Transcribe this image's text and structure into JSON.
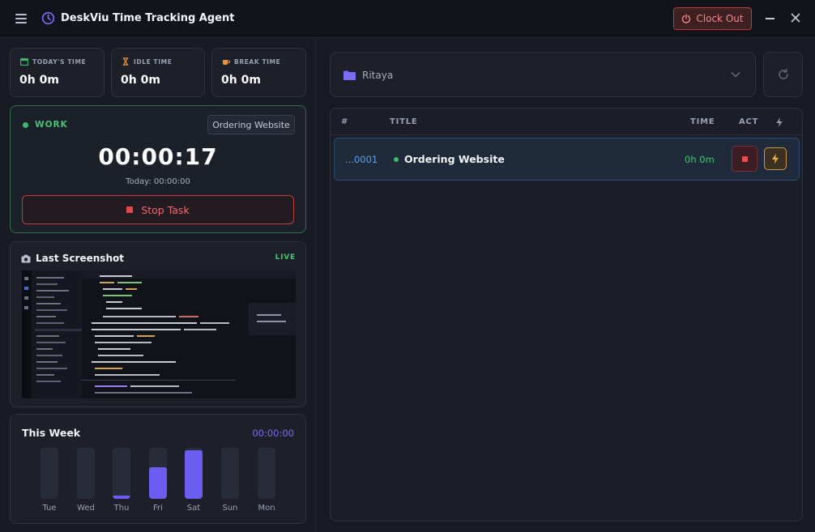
{
  "app": {
    "title": "DeskViu Time Tracking Agent",
    "clock_out_label": "Clock Out"
  },
  "stats": [
    {
      "label": "TODAY'S TIME",
      "value": "0h 0m",
      "icon": "calendar-icon",
      "color": "#3fb86b"
    },
    {
      "label": "IDLE TIME",
      "value": "0h 0m",
      "icon": "hourglass-icon",
      "color": "#e8913a"
    },
    {
      "label": "BREAK TIME",
      "value": "0h 0m",
      "icon": "coffee-icon",
      "color": "#e8913a"
    }
  ],
  "work": {
    "status_label": "WORK",
    "project_tag": "Ordering Website",
    "timer": "00:00:17",
    "today_line": "Today: 00:00:00",
    "stop_label": "Stop Task"
  },
  "screenshot": {
    "title": "Last Screenshot",
    "live_label": "LIVE"
  },
  "week": {
    "title": "This Week",
    "total": "00:00:00",
    "days": [
      {
        "label": "Tue",
        "level": 0.0
      },
      {
        "label": "Wed",
        "level": 0.0
      },
      {
        "label": "Thu",
        "level": 0.06
      },
      {
        "label": "Fri",
        "level": 0.62
      },
      {
        "label": "Sat",
        "level": 0.96
      },
      {
        "label": "Sun",
        "level": 0.0
      },
      {
        "label": "Mon",
        "level": 0.0
      }
    ]
  },
  "project_select": {
    "value": "Ritaya"
  },
  "table": {
    "headers": {
      "num": "#",
      "title": "TITLE",
      "time": "TIME",
      "act": "ACT"
    },
    "rows": [
      {
        "num": "...0001",
        "title": "Ordering Website",
        "time": "0h 0m"
      }
    ]
  },
  "colors": {
    "accent": "#6c5df2",
    "success": "#3fb86b",
    "danger": "#e2474d",
    "warning": "#c99a3c"
  }
}
